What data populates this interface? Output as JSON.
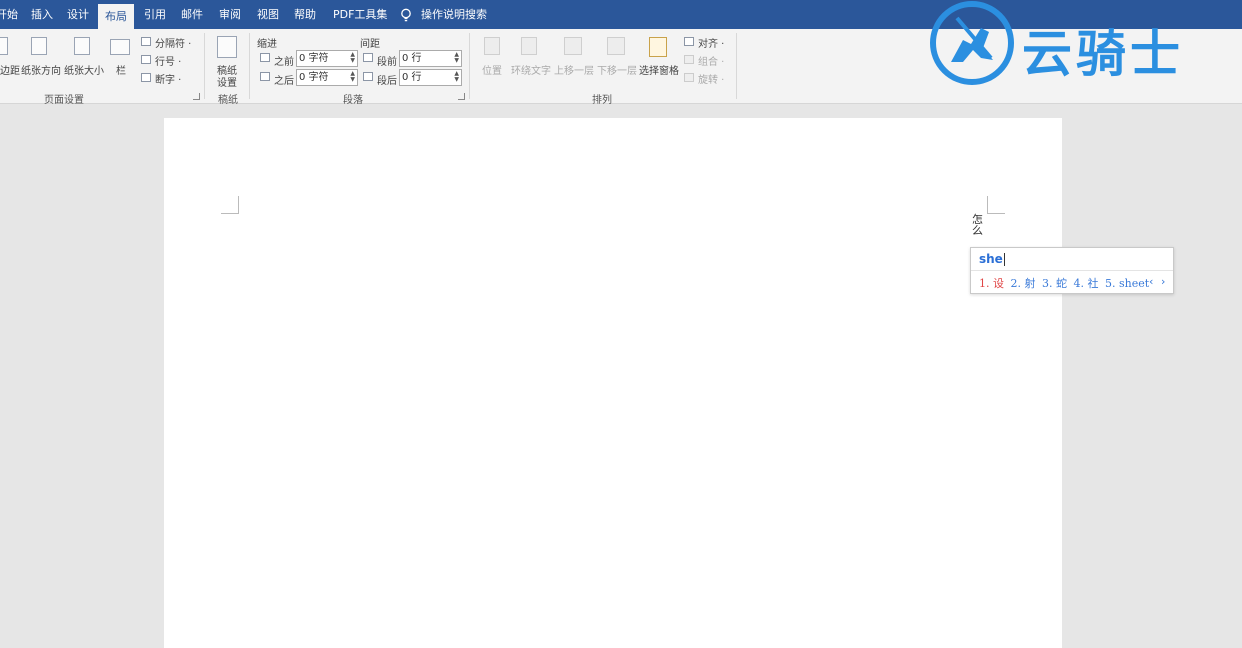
{
  "tabs": [
    "开始",
    "插入",
    "设计",
    "布局",
    "引用",
    "邮件",
    "审阅",
    "视图",
    "帮助",
    "PDF工具集",
    "操作说明搜索"
  ],
  "ribbon": {
    "page_setup": {
      "margins": "边距",
      "orientation": "纸张方向",
      "size": "纸张大小",
      "columns": "栏",
      "breaks": "分隔符 ·",
      "line_numbers": "行号 ·",
      "hyphenation": "断字 ·",
      "group": "页面设置"
    },
    "manuscript": {
      "settings_line1": "稿纸",
      "settings_line2": "设置",
      "group": "稿纸"
    },
    "paragraph": {
      "indent": "缩进",
      "spacing": "间距",
      "before_label": "之前",
      "after_label": "之后",
      "indent_before": "0 字符",
      "indent_after": "0 字符",
      "space_before_label": "段前",
      "space_after_label": "段后",
      "space_before": "0 行",
      "space_after": "0 行",
      "group": "段落"
    },
    "arrange": {
      "position": "位置",
      "wrap_text": "环绕文字",
      "bring_forward": "上移一层",
      "send_backward": "下移一层",
      "selection_pane": "选择窗格",
      "align": "对齐 ·",
      "group_btn": "组合 ·",
      "rotate": "旋转 ·",
      "group": "排列"
    }
  },
  "logo": {
    "text": "云骑士"
  },
  "document": {
    "vertical_text": [
      "怎",
      "么"
    ]
  },
  "ime": {
    "input": "she",
    "candidates": [
      "1. 设",
      "2. 射",
      "3. 蛇",
      "4. 社",
      "5. sheet"
    ],
    "prev": "‹",
    "next": "›"
  },
  "colors": {
    "tabbar": "#2b579a",
    "logo": "#2b8fe0",
    "ime_input": "#2b6fd6",
    "ime_first": "#e04646"
  }
}
